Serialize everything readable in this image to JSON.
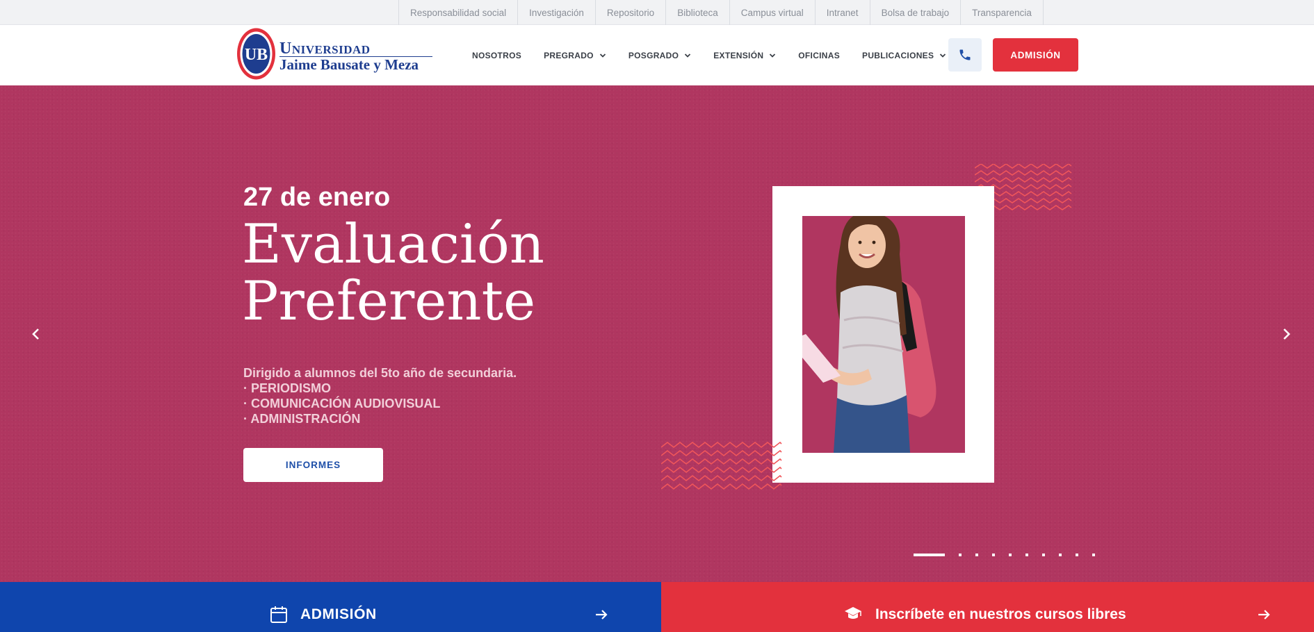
{
  "topbar": {
    "links": [
      "Responsabilidad social",
      "Investigación",
      "Repositorio",
      "Biblioteca",
      "Campus virtual",
      "Intranet",
      "Bolsa de trabajo",
      "Transparencia"
    ]
  },
  "logo": {
    "seal_text": "UB",
    "line1": "Universidad",
    "line2": "Jaime Bausate y Meza"
  },
  "nav": {
    "items": [
      {
        "label": "NOSOTROS",
        "icon": "none"
      },
      {
        "label": "PREGRADO",
        "icon": "chevron-down-icon"
      },
      {
        "label": "POSGRADO",
        "icon": "chevron-down-icon"
      },
      {
        "label": "EXTENSIÓN",
        "icon": "chevron-down-icon"
      },
      {
        "label": "OFICINAS",
        "icon": "none"
      },
      {
        "label": "PUBLICACIONES",
        "icon": "chevron-down-icon"
      }
    ],
    "phone_icon": "phone-icon",
    "admission_label": "ADMISIÓN"
  },
  "hero": {
    "date": "27 de enero",
    "title_line1": "Evaluación",
    "title_line2": "Preferente",
    "description": [
      "Dirigido a alumnos del 5to año de secundaria.",
      "· PERIODISMO",
      "· COMUNICACIÓN AUDIOVISUAL",
      "· ADMINISTRACIÓN"
    ],
    "button_label": "INFORMES",
    "slide_count": 10,
    "active_slide": 1
  },
  "bottom": {
    "left_label": "ADMISIÓN",
    "left_icon": "calendar-icon",
    "right_label": "Inscríbete en nuestros cursos libres",
    "right_icon": "graduation-cap-icon",
    "arrow_icon": "arrow-right-icon"
  },
  "colors": {
    "hero_bg": "#b03660",
    "brand_red": "#e3313d",
    "brand_blue": "#0f45ad",
    "logo_blue": "#1e3d8f",
    "wave": "#f0565a"
  }
}
